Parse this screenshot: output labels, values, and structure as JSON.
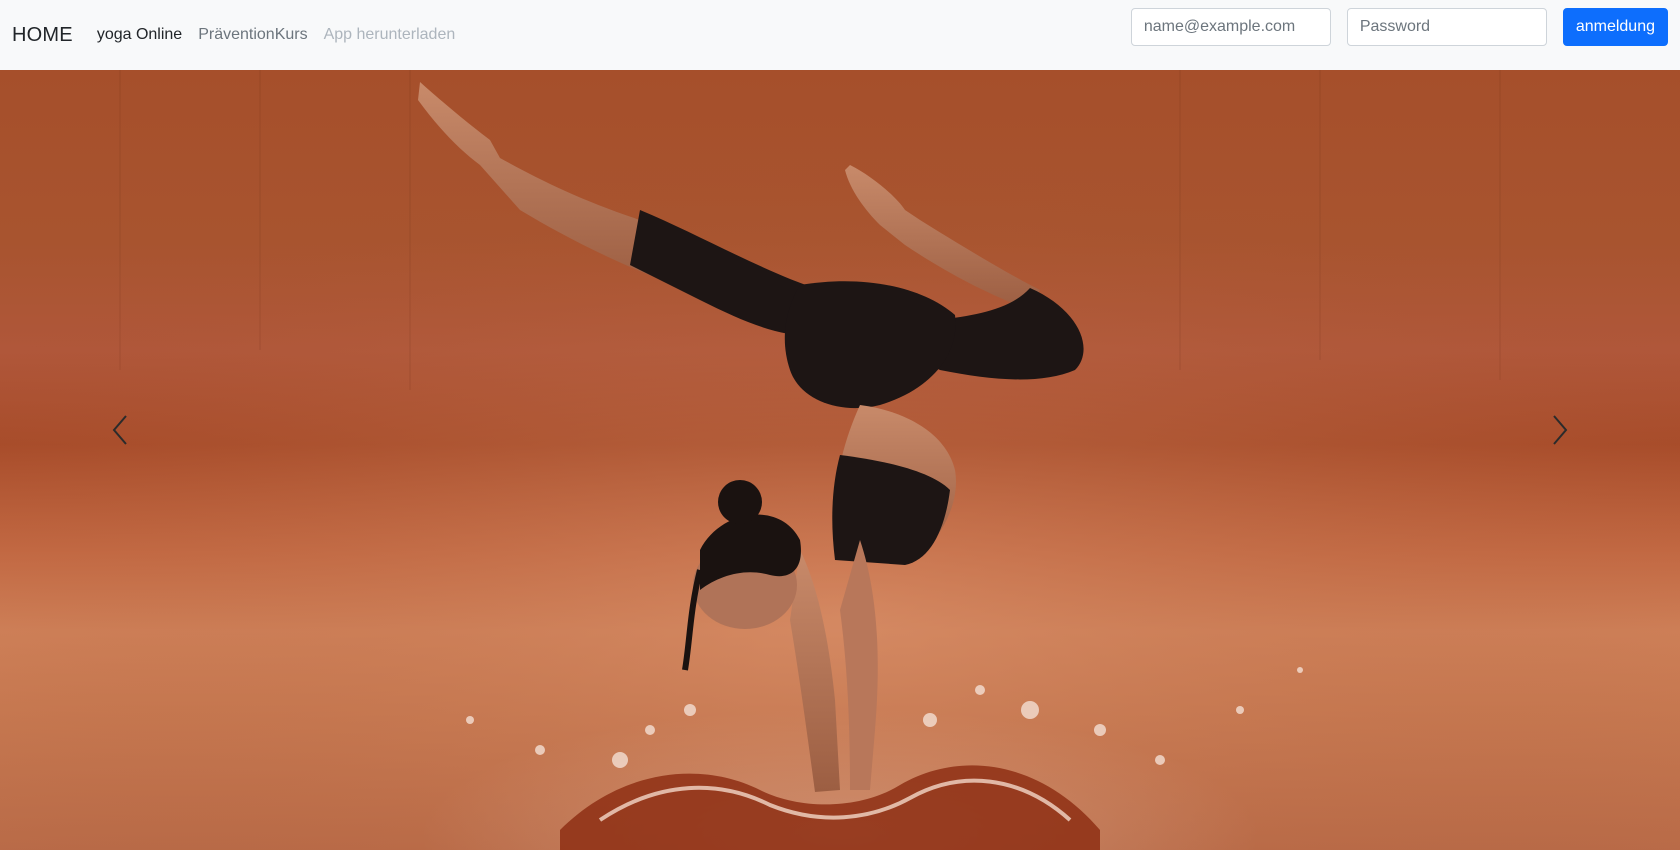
{
  "navbar": {
    "brand": "HOME",
    "links": [
      {
        "label": "yoga Online"
      },
      {
        "label": "PräventionKurs"
      },
      {
        "label": "App herunterladen"
      }
    ],
    "login": {
      "email_placeholder": "name@example.com",
      "password_placeholder": "Password",
      "submit_label": "anmeldung"
    }
  },
  "carousel": {
    "prev_icon": "chevron-left-icon",
    "next_icon": "chevron-right-icon",
    "slide_description": "yoga-handstand-photo"
  },
  "colors": {
    "navbar_bg": "#f8f9fa",
    "primary": "#0d6efd",
    "backdrop": "#a8542f"
  }
}
